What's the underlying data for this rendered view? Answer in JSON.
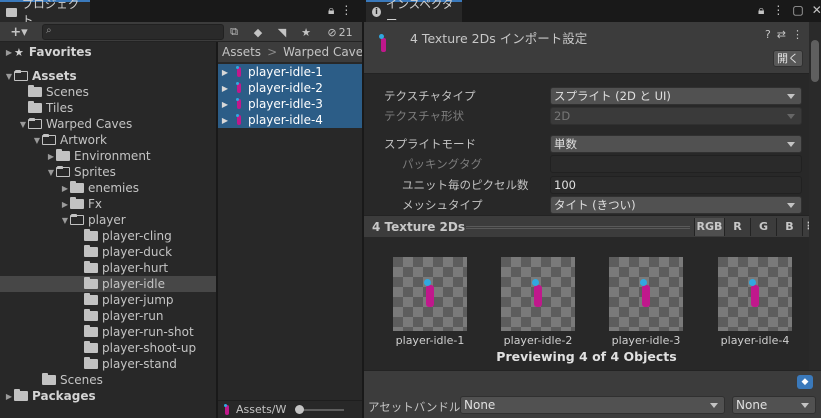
{
  "project": {
    "tab_label": "プロジェクト",
    "toolbar": {
      "add_label": "+▾",
      "search_placeholder": "",
      "hidden_count": "21"
    },
    "tree": [
      {
        "label": "Favorites",
        "depth": 0,
        "expanded": false,
        "type": "star",
        "bold": true
      },
      {
        "label": "Assets",
        "depth": 0,
        "expanded": true,
        "type": "folder",
        "bold": true
      },
      {
        "label": "Scenes",
        "depth": 1,
        "expanded": null,
        "type": "folder"
      },
      {
        "label": "Tiles",
        "depth": 1,
        "expanded": null,
        "type": "folder"
      },
      {
        "label": "Warped Caves",
        "depth": 1,
        "expanded": true,
        "type": "folder"
      },
      {
        "label": "Artwork",
        "depth": 2,
        "expanded": true,
        "type": "folder"
      },
      {
        "label": "Environment",
        "depth": 3,
        "expanded": false,
        "type": "folder"
      },
      {
        "label": "Sprites",
        "depth": 3,
        "expanded": true,
        "type": "folder"
      },
      {
        "label": "enemies",
        "depth": 4,
        "expanded": false,
        "type": "folder"
      },
      {
        "label": "Fx",
        "depth": 4,
        "expanded": false,
        "type": "folder"
      },
      {
        "label": "player",
        "depth": 4,
        "expanded": true,
        "type": "folder"
      },
      {
        "label": "player-cling",
        "depth": 5,
        "expanded": null,
        "type": "folder"
      },
      {
        "label": "player-duck",
        "depth": 5,
        "expanded": null,
        "type": "folder"
      },
      {
        "label": "player-hurt",
        "depth": 5,
        "expanded": null,
        "type": "folder"
      },
      {
        "label": "player-idle",
        "depth": 5,
        "expanded": null,
        "type": "folder",
        "selected": true
      },
      {
        "label": "player-jump",
        "depth": 5,
        "expanded": null,
        "type": "folder"
      },
      {
        "label": "player-run",
        "depth": 5,
        "expanded": null,
        "type": "folder"
      },
      {
        "label": "player-run-shot",
        "depth": 5,
        "expanded": null,
        "type": "folder"
      },
      {
        "label": "player-shoot-up",
        "depth": 5,
        "expanded": null,
        "type": "folder"
      },
      {
        "label": "player-stand",
        "depth": 5,
        "expanded": null,
        "type": "folder"
      },
      {
        "label": "Scenes",
        "depth": 2,
        "expanded": null,
        "type": "folder"
      },
      {
        "label": "Packages",
        "depth": 0,
        "expanded": false,
        "type": "folder",
        "bold": true
      }
    ],
    "breadcrumb": [
      "Assets",
      "Warped Caves"
    ],
    "breadcrumb_sep": ">",
    "assets": [
      "player-idle-1",
      "player-idle-2",
      "player-idle-3",
      "player-idle-4"
    ],
    "footer_path": "Assets/W"
  },
  "inspector": {
    "tab_label": "インスペクター",
    "title": "4 Texture 2Ds インポート設定",
    "open_button": "開く",
    "properties": [
      {
        "label": "テクスチャタイプ",
        "value": "スプライト (2D と UI)",
        "kind": "dropdown",
        "indent": false,
        "disabled": false
      },
      {
        "label": "テクスチャ形状",
        "value": "2D",
        "kind": "dropdown",
        "indent": false,
        "disabled": true
      },
      {
        "label": "スプライトモード",
        "value": "単数",
        "kind": "dropdown",
        "indent": false,
        "disabled": false
      },
      {
        "label": "パッキングタグ",
        "value": "",
        "kind": "field",
        "indent": true,
        "disabled": true
      },
      {
        "label": "ユニット毎のピクセル数",
        "value": "100",
        "kind": "field",
        "indent": true,
        "disabled": false
      },
      {
        "label": "メッシュタイプ",
        "value": "タイト (きつい)",
        "kind": "dropdown",
        "indent": true,
        "disabled": false
      }
    ],
    "preview": {
      "title": "4 Texture 2Ds",
      "channels": [
        "RGB",
        "R",
        "G",
        "B"
      ],
      "thumbnails": [
        "player-idle-1",
        "player-idle-2",
        "player-idle-3",
        "player-idle-4"
      ],
      "status": "Previewing 4 of 4 Objects"
    },
    "asset_bundle": {
      "label": "アセットバンドル",
      "name": "None",
      "variant": "None"
    }
  },
  "colors": {
    "selection": "#2c5d87",
    "tab_accent": "#3a79bb",
    "sprite_magenta": "#c0188c",
    "sprite_cyan": "#31a8e0"
  }
}
